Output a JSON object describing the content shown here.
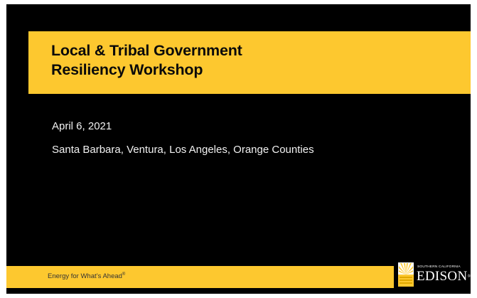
{
  "slide": {
    "title_line1": "Local & Tribal Government",
    "title_line2": "Resiliency Workshop",
    "date": "April 6, 2021",
    "counties": "Santa Barbara, Ventura, Los Angeles, Orange Counties",
    "tagline": "Energy for What’s Ahead",
    "tagline_mark": "®",
    "logo_small": "SOUTHERN CALIFORNIA",
    "logo_main": "EDISON",
    "logo_mark": "®"
  },
  "colors": {
    "background": "#000000",
    "accent_yellow": "#fdc82f",
    "text_light": "#f2f2f2",
    "text_dark": "#0a0a0a"
  },
  "icons": {
    "logo_mark": "edison-sunburst-icon"
  }
}
